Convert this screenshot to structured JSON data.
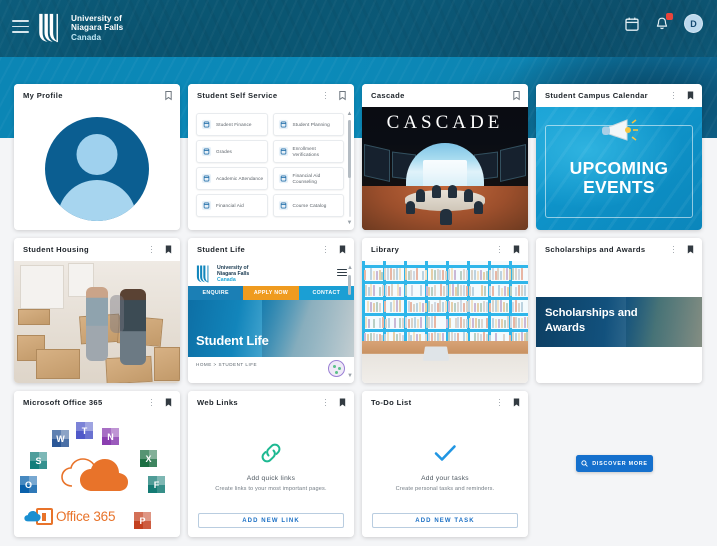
{
  "header": {
    "menu_icon": "hamburger-icon",
    "logo_line1": "University of",
    "logo_line2": "Niagara Falls",
    "logo_line3": "Canada",
    "calendar_icon": "calendar-icon",
    "notifications_icon": "bell-icon",
    "notification_badge": "",
    "avatar_initial": "D",
    "accent_teal": "#0b5a79",
    "accent_cyan": "#0b86b5"
  },
  "cards": {
    "my_profile": {
      "title": "My Profile",
      "bookmark": "bookmark-outline-icon"
    },
    "student_self_service": {
      "title": "Student Self Service",
      "bookmark": "bookmark-outline-icon",
      "items": [
        {
          "label": "Student Finance",
          "icon": "finance-icon"
        },
        {
          "label": "Student Planning",
          "icon": "calendar-icon"
        },
        {
          "label": "Grades",
          "icon": "grades-icon"
        },
        {
          "label": "Enrollment Verifications",
          "icon": "clipboard-icon"
        },
        {
          "label": "Academic Attendance",
          "icon": "attendance-icon"
        },
        {
          "label": "Financial Aid Counseling",
          "icon": "aid-counseling-icon"
        },
        {
          "label": "Financial Aid",
          "icon": "financial-aid-icon"
        },
        {
          "label": "Course Catalog",
          "icon": "catalog-icon"
        }
      ]
    },
    "cascade": {
      "title": "Cascade",
      "bookmark": "bookmark-outline-icon",
      "banner_text": "CASCADE"
    },
    "student_campus_calendar": {
      "title": "Student Campus Calendar",
      "bookmark": "bookmark-filled-icon",
      "banner_line1": "UPCOMING",
      "banner_line2": "EVENTS",
      "megaphone": "megaphone-icon"
    },
    "student_housing": {
      "title": "Student Housing",
      "bookmark": "bookmark-filled-icon"
    },
    "student_life": {
      "title": "Student Life",
      "bookmark": "bookmark-filled-icon",
      "site_logo_line1": "University of",
      "site_logo_line2": "Niagara Falls",
      "site_logo_line3": "Canada",
      "nav": [
        {
          "label": "ENQUIRE",
          "color": "#1b7fb5"
        },
        {
          "label": "APPLY NOW",
          "color": "#ef9b1f"
        },
        {
          "label": "CONTACT",
          "color": "#1b9fd4"
        }
      ],
      "hero_title": "Student Life",
      "breadcrumb": "HOME  >  STUDENT LIFE",
      "cookie_icon": "cookie-icon"
    },
    "library": {
      "title": "Library",
      "bookmark": "bookmark-filled-icon"
    },
    "scholarships": {
      "title": "Scholarships and Awards",
      "bookmark": "bookmark-filled-icon",
      "banner_line1": "Scholarships and",
      "banner_line2": "Awards"
    },
    "office365": {
      "title": "Microsoft Office 365",
      "bookmark": "bookmark-filled-icon",
      "logo_text": "Office 365",
      "apps": [
        {
          "name": "Word",
          "letter": "W",
          "color": "#2b5797"
        },
        {
          "name": "Teams",
          "letter": "T",
          "color": "#5059c9"
        },
        {
          "name": "OneNote",
          "letter": "N",
          "color": "#8a3eb0"
        },
        {
          "name": "SharePoint",
          "letter": "S",
          "color": "#137e7b"
        },
        {
          "name": "Excel",
          "letter": "X",
          "color": "#1d7044"
        },
        {
          "name": "Outlook",
          "letter": "O",
          "color": "#0a61ab"
        },
        {
          "name": "Forms",
          "letter": "F",
          "color": "#147b74"
        },
        {
          "name": "PowerPoint",
          "letter": "P",
          "color": "#c4401f"
        },
        {
          "name": "OneDrive",
          "letter": "",
          "color": "#1a8fd1"
        }
      ]
    },
    "web_links": {
      "title": "Web Links",
      "bookmark": "bookmark-filled-icon",
      "icon": "link-chain-icon",
      "empty_title": "Add quick links",
      "empty_subtitle": "Create links to your most important pages.",
      "button": "ADD NEW LINK"
    },
    "todo_list": {
      "title": "To-Do List",
      "bookmark": "bookmark-filled-icon",
      "icon": "checkmark-icon",
      "empty_title": "Add your tasks",
      "empty_subtitle": "Create personal tasks and reminders.",
      "button": "ADD NEW TASK"
    }
  },
  "discover": {
    "label": "DISCOVER MORE",
    "icon": "search-icon"
  }
}
